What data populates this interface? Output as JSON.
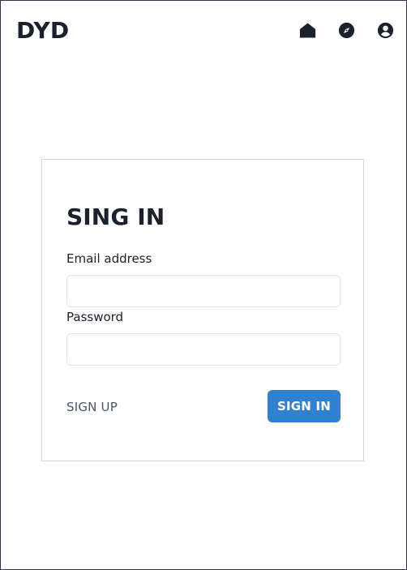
{
  "header": {
    "logo": "DYD",
    "nav": [
      {
        "icon": "home-icon"
      },
      {
        "icon": "compass-icon"
      },
      {
        "icon": "user-circle-icon"
      }
    ]
  },
  "signin": {
    "title": "SING IN",
    "email_label": "Email address",
    "email_value": "",
    "password_label": "Password",
    "password_value": "",
    "signup_label": "SIGN UP",
    "signin_label": "SIGN IN"
  },
  "colors": {
    "text": "#1a202c",
    "muted": "#4a5568",
    "primary": "#3182ce",
    "border": "#d2d6dc",
    "input_border": "#e2e8f0"
  }
}
